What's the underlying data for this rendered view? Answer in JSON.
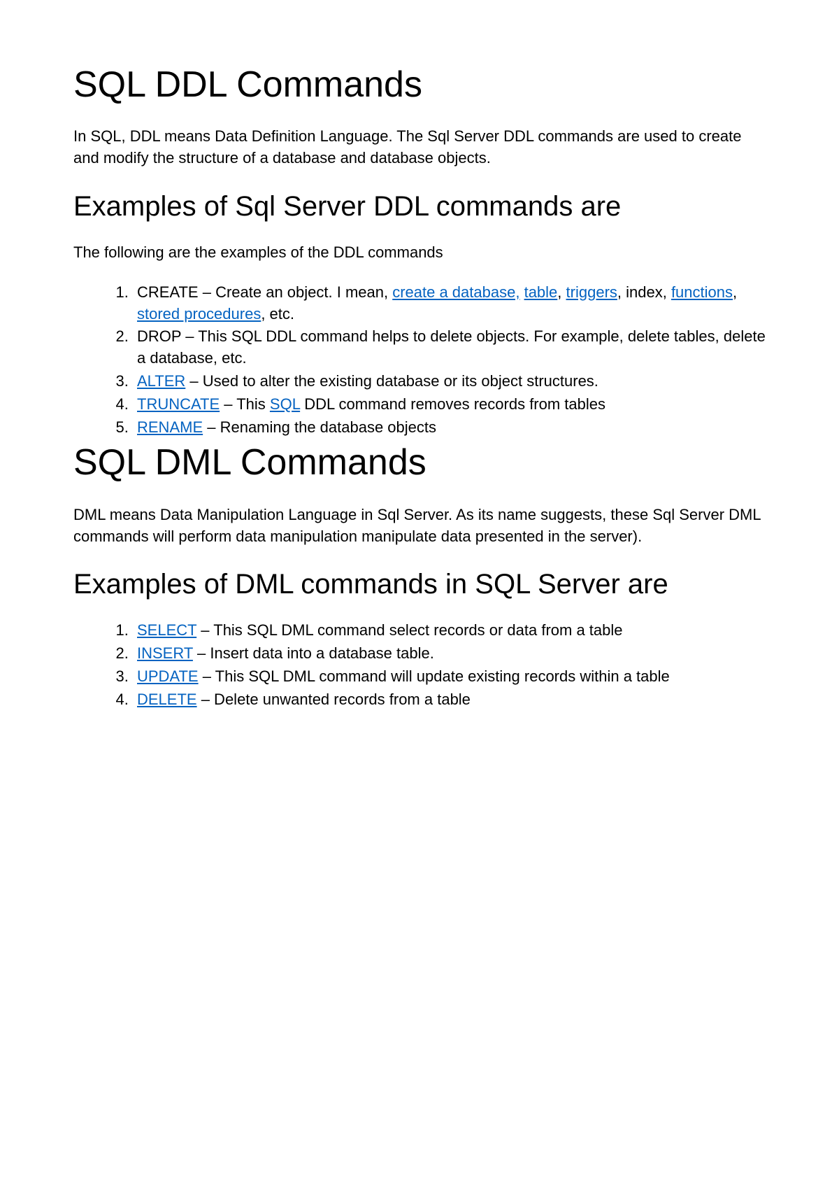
{
  "section1": {
    "title": "SQL DDL Commands",
    "intro": "In SQL, DDL means Data Definition Language. The Sql Server DDL commands are used to create and modify the structure of a database and database objects.",
    "subheading": "Examples of Sql Server DDL commands are",
    "lead": "The following are the examples of the DDL commands",
    "items": {
      "i1": {
        "pre": "CREATE – Create an object. I mean, ",
        "link1": "create a database,",
        "sep1": " ",
        "link2": "table",
        "sep2": ", ",
        "link3": "triggers",
        "sep3": ", index, ",
        "link4": "functions",
        "sep4": ", ",
        "link5": "stored procedures",
        "post": ", etc."
      },
      "i2": "DROP – This SQL DDL command helps to delete objects. For example, delete tables, delete a database, etc.",
      "i3": {
        "link": "ALTER",
        "post": " – Used to alter the existing database or its object structures."
      },
      "i4": {
        "link1": "TRUNCATE",
        "mid1": " – This ",
        "link2": "SQL",
        "post": " DDL command removes records from tables"
      },
      "i5": {
        "link": "RENAME",
        "post": " – Renaming the database objects"
      }
    }
  },
  "section2": {
    "title": "SQL DML Commands",
    "intro": "DML means Data Manipulation Language in Sql Server. As its name suggests, these Sql Server DML commands will perform data manipulation manipulate data presented in the server).",
    "subheading": "Examples of DML commands  in SQL Server are",
    "items": {
      "i1": {
        "link": "SELECT",
        "post": " – This SQL DML command select records or data from a table"
      },
      "i2": {
        "link": "INSERT",
        "post": " – Insert data into a database table."
      },
      "i3": {
        "link": "UPDATE",
        "post": " – This SQL DML command will update existing records within a table"
      },
      "i4": {
        "link": "DELETE",
        "post": " – Delete unwanted records from a table"
      }
    }
  }
}
